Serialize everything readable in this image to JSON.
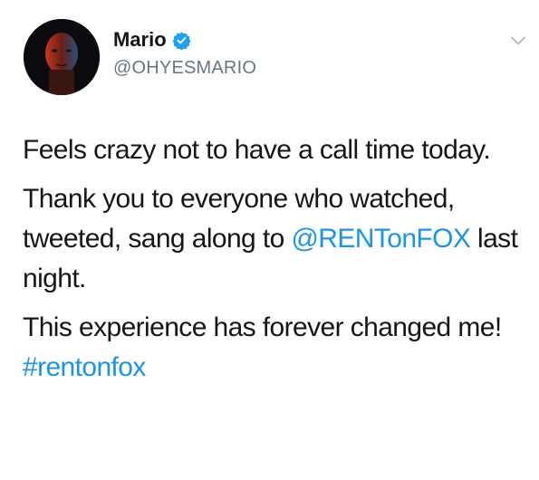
{
  "user": {
    "display_name": "Mario",
    "handle": "@OHYESMARIO",
    "verified": true,
    "verified_icon": "verified-badge-icon",
    "verified_color": "#1da1f2"
  },
  "menu": {
    "icon": "chevron-down-icon"
  },
  "tweet": {
    "p1": "Feels crazy not to have a call time today.",
    "p2_before": "Thank you to everyone who watched, tweeted, sang along to ",
    "p2_mention": "@RENTonFOX",
    "p2_after": " last night.",
    "p3_before": "This experience has forever changed me! ",
    "p3_hashtag": "#rentonfox"
  },
  "colors": {
    "text": "#14171a",
    "secondary": "#657786",
    "link": "#1b95e0"
  }
}
